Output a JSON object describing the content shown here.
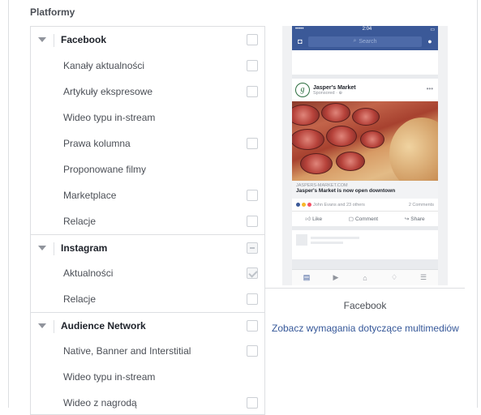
{
  "section_title": "Platformy",
  "platforms": [
    {
      "name": "Facebook",
      "checkbox": "unchecked",
      "children": [
        {
          "label": "Kanały aktualności",
          "checkbox": "unchecked"
        },
        {
          "label": "Artykuły ekspresowe",
          "checkbox": "unchecked"
        },
        {
          "label": "Wideo typu in-stream",
          "checkbox": "none"
        },
        {
          "label": "Prawa kolumna",
          "checkbox": "unchecked"
        },
        {
          "label": "Proponowane filmy",
          "checkbox": "none"
        },
        {
          "label": "Marketplace",
          "checkbox": "unchecked"
        },
        {
          "label": "Relacje",
          "checkbox": "unchecked"
        }
      ]
    },
    {
      "name": "Instagram",
      "checkbox": "indeterminate",
      "children": [
        {
          "label": "Aktualności",
          "checkbox": "checked"
        },
        {
          "label": "Relacje",
          "checkbox": "unchecked"
        }
      ]
    },
    {
      "name": "Audience Network",
      "checkbox": "unchecked",
      "children": [
        {
          "label": "Native, Banner and Interstitial",
          "checkbox": "unchecked"
        },
        {
          "label": "Wideo typu in-stream",
          "checkbox": "none"
        },
        {
          "label": "Wideo z nagrodą",
          "checkbox": "unchecked"
        }
      ]
    }
  ],
  "preview": {
    "status_time": "2:04",
    "search_placeholder": "Search",
    "page_name": "Jasper's Market",
    "sponsored": "Sponsored · ⊕",
    "link_domain": "JASPERS-MARKET.COM",
    "link_title": "Jasper's Market is now open downtown",
    "reactions_text": "John Evans and 23 others",
    "comments_count": "2 Comments",
    "actions": [
      "Like",
      "Comment",
      "Share"
    ],
    "caption": "Facebook"
  },
  "media_requirements_link": "Zobacz wymagania dotyczące multimediów",
  "colors": {
    "brand_blue": "#3b5998",
    "link_blue": "#365899",
    "border": "#dddfe2",
    "text": "#4b4f56"
  }
}
